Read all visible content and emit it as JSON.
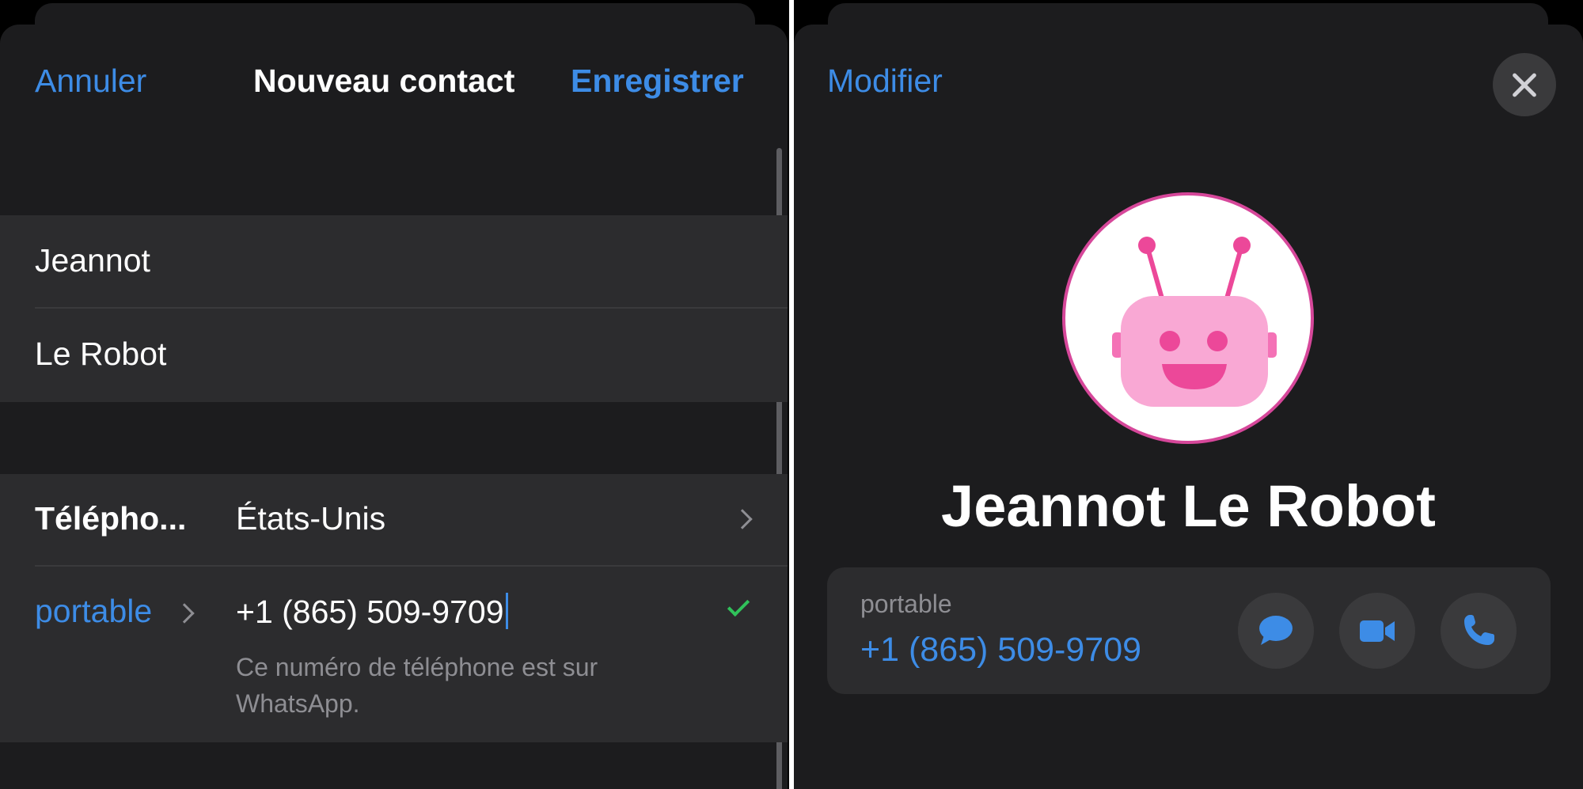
{
  "left": {
    "nav": {
      "cancel_label": "Annuler",
      "title": "Nouveau contact",
      "save_label": "Enregistrer"
    },
    "name_fields": {
      "first_name": "Jeannot",
      "last_name": "Le Robot"
    },
    "phone": {
      "field_label": "Télépho...",
      "country": "États-Unis",
      "type_label": "portable",
      "number": "+1  (865) 509-9709",
      "hint": "Ce numéro de téléphone est sur WhatsApp."
    }
  },
  "right": {
    "nav": {
      "edit_label": "Modifier"
    },
    "contact_name": "Jeannot Le Robot",
    "phone_card": {
      "label": "portable",
      "number": "+1 (865) 509-9709"
    }
  },
  "colors": {
    "accent": "#3d8ce6",
    "background": "#000000",
    "panel": "#1c1c1e",
    "cell": "#2c2c2e",
    "success": "#30c25a",
    "avatar_border": "#d6479a",
    "robot_pink": "#f9a8d4",
    "robot_accent": "#ec4899"
  },
  "icons": {
    "close": "close-icon",
    "message": "message-bubble-icon",
    "video": "video-camera-icon",
    "phone": "phone-handset-icon",
    "chevron": "chevron-right-icon",
    "check": "checkmark-icon"
  }
}
